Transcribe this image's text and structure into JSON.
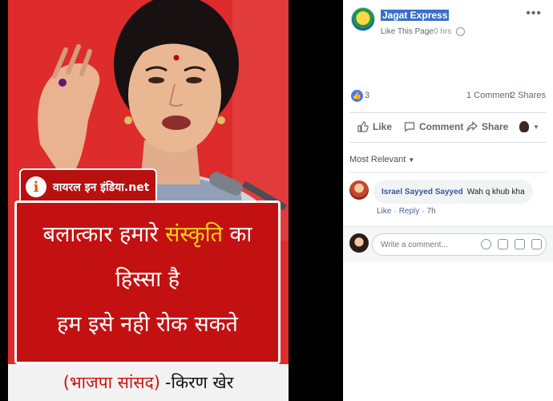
{
  "graphic": {
    "brand": "वायरल इन इंडिया.net",
    "brand_logo": "i",
    "quote_lines": [
      {
        "part1": "बलात्कार हमारे ",
        "part2": "संस्कृति",
        "part3": " का"
      },
      {
        "text": "हिस्सा है"
      },
      {
        "text": "हम इसे नही रोक सकते"
      }
    ],
    "caption_party": "(भाजपा सांसद)",
    "caption_name": "-किरण खेर"
  },
  "post": {
    "page_name": "Jagat Express",
    "like_page": "Like This Page",
    "time": "0 hrs",
    "reaction_count": "3",
    "comment_count": "1 Comment",
    "share_count": "2 Shares",
    "more_icon": "more-options-icon"
  },
  "actions": {
    "like": "Like",
    "comment": "Comment",
    "share": "Share"
  },
  "comments_section": {
    "sort_label": "Most Relevant",
    "comments": [
      {
        "author": "Israel Sayyed Sayyed",
        "text": "Wah q khub kha",
        "like": "Like",
        "reply": "Reply",
        "time": "7h"
      }
    ],
    "input_placeholder": "Write a comment..."
  },
  "colors": {
    "facebook_blue": "#4267b2",
    "poster_red": "#c31111",
    "poster_yellow": "#f7d515"
  }
}
